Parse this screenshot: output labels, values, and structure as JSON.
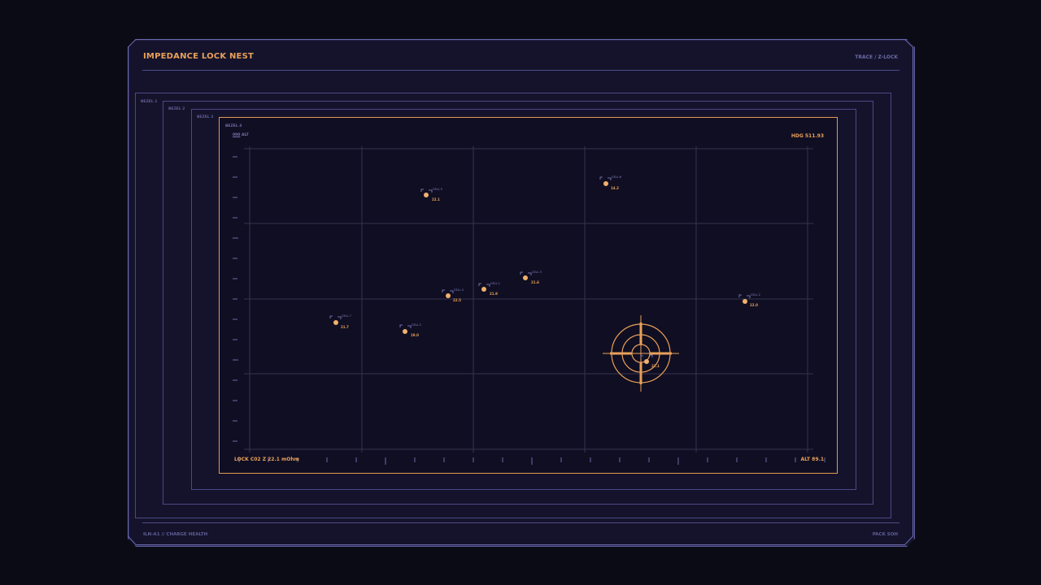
{
  "header": {
    "title": "IMPEDANCE LOCK NEST",
    "nav_left": "TRACE",
    "nav_sep": "/",
    "nav_right": "Z-LOCK"
  },
  "bezels": [
    "BEZEL 1",
    "BEZEL 2",
    "BEZEL 3",
    "BEZEL 4"
  ],
  "plot": {
    "heading_readout": "HDG 511.93",
    "alt_scale_label": "ALT",
    "lock_readout": "LOCK C02 Z 22.1 mOhm",
    "alt_readout": "ALT 89.1"
  },
  "cells": [
    {
      "id": "CELL 01",
      "label": "CELL 5",
      "z": "22.1"
    },
    {
      "id": "CELL 02",
      "label": "CELL 6",
      "z": "14.2"
    },
    {
      "id": "CELL 03",
      "label": "CELL 4",
      "z": "22.5"
    },
    {
      "id": "CELL 04",
      "label": "CELL 1",
      "z": "21.9"
    },
    {
      "id": "CELL 05",
      "label": "CELL 3",
      "z": "21.6"
    },
    {
      "id": "CELL 06",
      "label": "CELL 7",
      "z": "21.7"
    },
    {
      "id": "CELL 07",
      "label": "CELL 2",
      "z": "19.0"
    },
    {
      "id": "CELL 08",
      "label": "CELL 2",
      "z": "22.0"
    },
    {
      "id": "CELL 09",
      "label": "CELL 2",
      "z": "22.1"
    }
  ],
  "footer": {
    "left": "ILN-A1",
    "sep": "//",
    "middle": "CHARGE HEALTH",
    "right": "PACK SOH"
  },
  "colors": {
    "accent": "#e8a05a",
    "frame": "#5b5a9c",
    "background": "#0b0b16"
  }
}
